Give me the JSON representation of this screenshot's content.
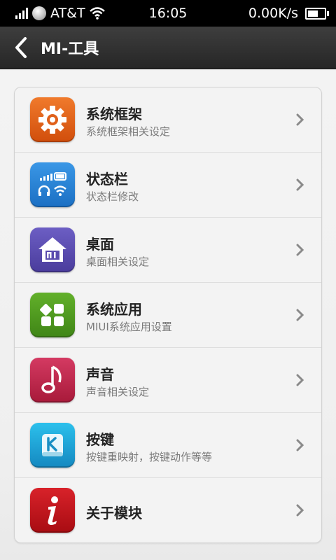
{
  "status_bar": {
    "carrier": "AT&T",
    "time": "16:05",
    "speed": "0.00K/s"
  },
  "header": {
    "title": "MI-工具"
  },
  "menu": {
    "items": [
      {
        "title": "系统框架",
        "subtitle": "系统框架相关设定",
        "icon": "gear-icon",
        "color": "#e8641c"
      },
      {
        "title": "状态栏",
        "subtitle": "状态栏修改",
        "icon": "statusbar-icon",
        "color": "#2a86d8"
      },
      {
        "title": "桌面",
        "subtitle": "桌面相关设定",
        "icon": "home-mi-icon",
        "color": "#5a4cae"
      },
      {
        "title": "系统应用",
        "subtitle": "MIUI系统应用设置",
        "icon": "apps-grid-icon",
        "color": "#4b9a1e"
      },
      {
        "title": "声音",
        "subtitle": "声音相关设定",
        "icon": "music-note-icon",
        "color": "#c0254c"
      },
      {
        "title": "按键",
        "subtitle": "按键重映射，按键动作等等",
        "icon": "key-k-icon",
        "color": "#1ea0d0"
      },
      {
        "title": "关于模块",
        "subtitle": "",
        "icon": "info-icon",
        "color": "#c8141c"
      }
    ]
  }
}
